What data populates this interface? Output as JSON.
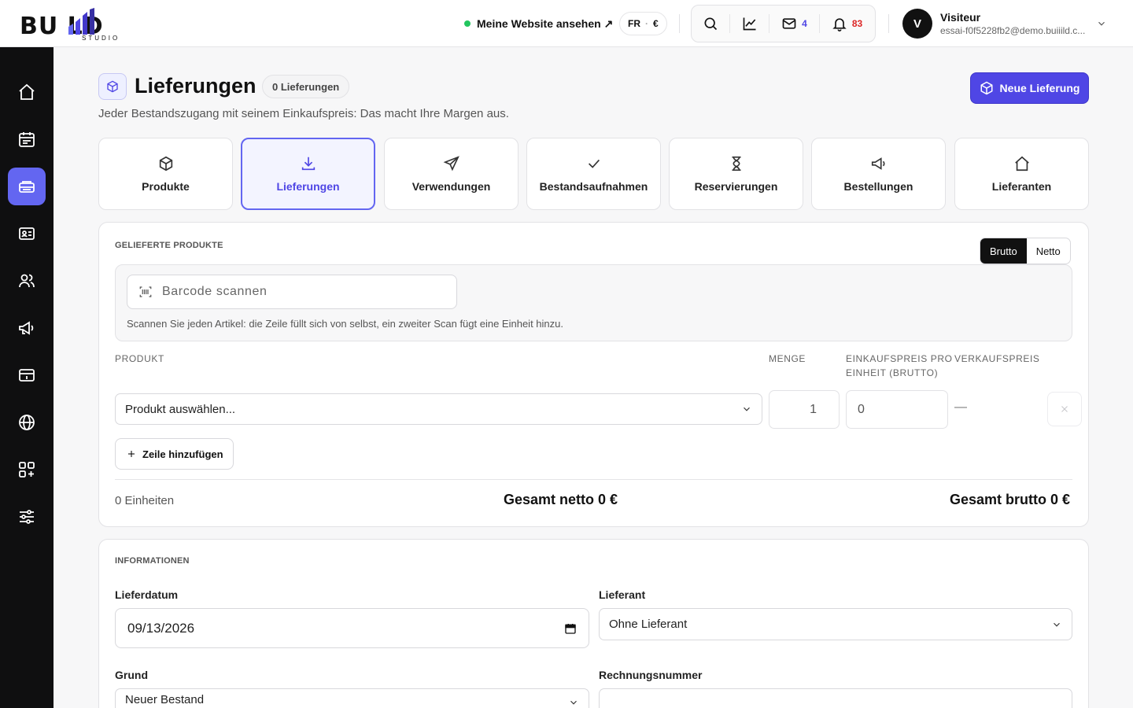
{
  "topbar": {
    "logo_text": "BUIILD",
    "logo_word": "BU    LD",
    "logo_sub": "STUDIO",
    "site_link": "Meine Website ansehen ↗",
    "lang": "FR",
    "lang_sep": "·",
    "currency": "€",
    "mail_count": "4",
    "notif_count": "83",
    "user_initial": "V",
    "user_name": "Visiteur",
    "user_email": "essai-f0f5228fb2@demo.buiiild.c..."
  },
  "header": {
    "title": "Lieferungen",
    "count_badge": "0 Lieferungen",
    "subtitle": "Jeder Bestandszugang mit seinem Einkaufspreis: Das macht Ihre Margen aus.",
    "primary_button": "Neue Lieferung"
  },
  "tabs": [
    {
      "label": "Produkte",
      "icon": "box-icon"
    },
    {
      "label": "Lieferungen",
      "icon": "download-icon",
      "active": true
    },
    {
      "label": "Verwendungen",
      "icon": "send-icon"
    },
    {
      "label": "Bestandsaufnahmen",
      "icon": "check-icon"
    },
    {
      "label": "Reservierungen",
      "icon": "hourglass-icon"
    },
    {
      "label": "Bestellungen",
      "icon": "megaphone-icon"
    },
    {
      "label": "Lieferanten",
      "icon": "home-icon"
    }
  ],
  "products_card": {
    "section_label": "GELIEFERTE PRODUKTE",
    "toggle": {
      "gross": "Brutto",
      "net": "Netto",
      "selected": "Brutto"
    },
    "scan_placeholder": "Barcode scannen",
    "scan_hint": "Scannen Sie jeden Artikel: die Zeile füllt sich von selbst, ein zweiter Scan fügt eine Einheit hinzu.",
    "columns": {
      "product": "PRODUKT",
      "quantity": "MENGE",
      "unit_price_1": "EINKAUFSPREIS PRO",
      "unit_price_2": "EINHEIT (BRUTTO)",
      "sale_price": "VERKAUFSPREIS"
    },
    "row": {
      "product_placeholder": "Produkt auswählen...",
      "quantity": "1",
      "unit_price": "0",
      "sale_price": "—"
    },
    "add_row": "Zeile hinzufügen",
    "units_summary": "0 Einheiten",
    "total_net": "Gesamt netto 0 €",
    "total_gross": "Gesamt brutto 0 €"
  },
  "info_card": {
    "section_label": "INFORMATIONEN",
    "delivery_date_label": "Lieferdatum",
    "delivery_date_value": "09/13/2026",
    "supplier_label": "Lieferant",
    "supplier_value": "Ohne Lieferant",
    "reason_label": "Grund",
    "reason_value": "Neuer Bestand",
    "invoice_label": "Rechnungsnummer",
    "invoice_value": ""
  },
  "sidebar": {
    "items": [
      {
        "icon": "home-icon"
      },
      {
        "icon": "calendar-icon"
      },
      {
        "icon": "inventory-icon",
        "active": true
      },
      {
        "icon": "id-card-icon"
      },
      {
        "icon": "users-icon"
      },
      {
        "icon": "megaphone-icon"
      },
      {
        "icon": "payment-icon"
      },
      {
        "icon": "globe-icon"
      },
      {
        "icon": "apps-icon"
      },
      {
        "icon": "sliders-icon"
      }
    ]
  },
  "colors": {
    "accent": "#4f46e5",
    "accent_light": "#6366f1",
    "sidebar_bg": "#0f0f10",
    "online": "#22c55e",
    "alert": "#dc2626"
  }
}
